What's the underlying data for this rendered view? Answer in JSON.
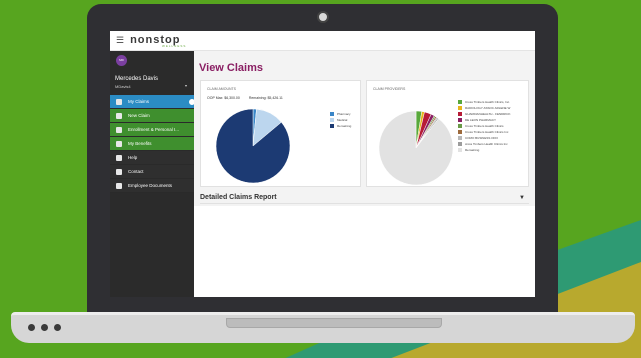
{
  "brand": {
    "name": "nonstop",
    "sub": "WELLNESS"
  },
  "user": {
    "initials": "MD",
    "name": "Mercedes Davis",
    "id": "MDavis4"
  },
  "nav": [
    {
      "label": "My Claims",
      "icon": "document-icon",
      "state": "active"
    },
    {
      "label": "New Claim",
      "icon": "new-document-icon",
      "state": "green"
    },
    {
      "label": "Enrollment & Personal I...",
      "icon": "enrollment-icon",
      "state": "green"
    },
    {
      "label": "My Benefits",
      "icon": "benefits-icon",
      "state": "green"
    },
    {
      "label": "Help",
      "icon": "help-icon",
      "state": "dark"
    },
    {
      "label": "Contact",
      "icon": "contact-icon",
      "state": "dark"
    },
    {
      "label": "Employee Documents",
      "icon": "folder-icon",
      "state": "dark"
    }
  ],
  "page": {
    "title": "View Claims"
  },
  "claim_amounts": {
    "title": "CLAIM AMOUNTS",
    "oop_max": "OOP Max: $6,300.00",
    "remaining": "Remaining: $5,426.11"
  },
  "claim_providers": {
    "title": "CLAIM PROVIDERS"
  },
  "report": {
    "title": "Detailed Claims Report"
  },
  "colors": {
    "accent": "#8a1f63",
    "active": "#2b8cc4",
    "nav_green": "#3f8f2e"
  },
  "chart_data": [
    {
      "type": "pie",
      "title": "CLAIM AMOUNTS",
      "categories": [
        "Pharmacy",
        "Medical",
        "Remaining"
      ],
      "values": [
        1.5,
        12.4,
        86.1
      ],
      "colors": [
        "#3a86c8",
        "#bcd6ee",
        "#1c3a73"
      ]
    },
    {
      "type": "pie",
      "title": "CLAIM PROVIDERS",
      "categories": [
        "Cross Timbers Health Clinics, Inc.",
        "RADIOLOGY ASSOC ARLENE W",
        "GUARDIANHEALTH - FENDRICK",
        "DE LEON PHARMACY",
        "Cross Timbers Health Clinics",
        "Cross Timbers Health Clinics Inc",
        "COMO BUSINESS OFFI",
        "cross Timbers Health Clinics Inc",
        "Remaining"
      ],
      "values": [
        2.5,
        1.2,
        3.0,
        1.5,
        0.6,
        0.6,
        0.5,
        0.5,
        89.6
      ],
      "colors": [
        "#58a83b",
        "#e7b51a",
        "#b71c37",
        "#8a1f63",
        "#6a9a47",
        "#9d6a3c",
        "#b8b8b8",
        "#9c9c9c",
        "#e2e2e2"
      ]
    }
  ]
}
